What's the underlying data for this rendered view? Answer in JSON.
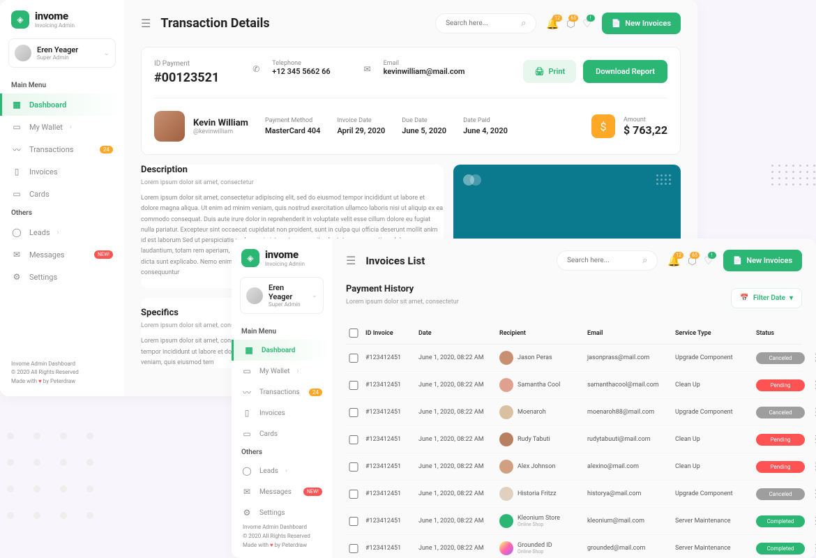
{
  "brand": {
    "title": "invome",
    "subtitle": "Invoicing Admin"
  },
  "user": {
    "name": "Eren Yeager",
    "role": "Super Admin"
  },
  "menu": {
    "main_label": "Main Menu",
    "others_label": "Others",
    "items": {
      "dashboard": "Dashboard",
      "wallet": "My Wallet",
      "transactions": "Transactions",
      "transactions_badge": "24",
      "invoices": "Invoices",
      "cards": "Cards",
      "leads": "Leads",
      "messages": "Messages",
      "messages_badge": "NEW!",
      "settings": "Settings"
    }
  },
  "footer": {
    "l1": "Invome Admin Dashboard",
    "l2": "© 2020 All Rights Reserved",
    "l3a": "Made with ",
    "l3b": " by Peterdraw"
  },
  "topbar": {
    "search_placeholder": "Search here...",
    "noti1": "12",
    "noti2": "65",
    "noti3": "!",
    "new_invoice_btn": "New Invoices"
  },
  "pageA": {
    "title": "Transaction Details",
    "id_payment_label": "ID Payment",
    "id_payment_value": "#00123521",
    "tel_label": "Telephone",
    "tel_value": "+12 345 5662 66",
    "email_label": "Email",
    "email_value": "kevinwilliam@mail.com",
    "print_btn": "Print",
    "download_btn": "Download Report",
    "customer_name": "Kevin William",
    "customer_handle": "@kevinwilliam",
    "pm_label": "Payment Method",
    "pm_value": "MasterCard 404",
    "inv_date_label": "Invoice Date",
    "inv_date_value": "April 29, 2020",
    "due_label": "Due Date",
    "due_value": "June 5, 2020",
    "paid_label": "Date Paid",
    "paid_value": "June 4, 2020",
    "amount_label": "Amount",
    "amount_value": "$ 763,22",
    "desc_title": "Description",
    "desc_sub": "Lorem ipsum dolor sit amet, consectetur",
    "desc_body": "Lorem ipsum dolor sit amet, consectetur adipiscing elit, sed do eiusmod tempor incididunt ut labore et dolore magna aliqua. Ut enim ad minim veniam, quis nostrud exercitation ullamco laboris nisi ut aliquip ex ea commodo consequat. Duis aute irure dolor in reprehenderit in voluptate velit esse cillum dolore eu fugiat nulla pariatur. Excepteur sint occaecat cupidatat non proident, sunt in culpa qui officia deserunt mollit anim id est laborum Sed ut perspiciatis unde omnis iste natus error sit voluptatem accusantium doloremque laudantium, totam rem aperiam, eaque ipsa quae ab illo inventore veritatis et quasi architecto beatae vitae dicta sunt explicabo. Nemo enim ipsam voluptatem quia voluptas sit aspernatur aut odit aut fugit, sed quia consequuntur",
    "spec_title": "Specifics",
    "spec_sub": "Lorem ipsum dolor sit amet, consectetur",
    "spec_body": "Lorem ipsum dolor sit amet, consectetur adipiscing elit, sed do eiusmod tempor incididunt ut labore et dolore magna aliqua. Ut enim ad minim veniam, quis eiusmod tem"
  },
  "pageB": {
    "title": "Invoices List",
    "history_title": "Payment History",
    "history_sub": "Lorem ipsum dolor sit amet, consectetur",
    "filter_btn": "Filter Date",
    "cols": {
      "id": "ID Invoice",
      "date": "Date",
      "recipient": "Recipient",
      "email": "Email",
      "service": "Service Type",
      "status": "Status"
    },
    "rows": [
      {
        "id": "#123412451",
        "date": "June 1, 2020, 08:22 AM",
        "name": "Jason Peras",
        "sub": "",
        "email": "jasonprass@mail.com",
        "service": "Upgrade Component",
        "status": "Canceled",
        "st": "cancel",
        "av": "#c89070"
      },
      {
        "id": "#123412451",
        "date": "June 1, 2020, 08:22 AM",
        "name": "Samantha Cool",
        "sub": "",
        "email": "samanthacool@mail.com",
        "service": "Clean Up",
        "status": "Pending",
        "st": "pending",
        "av": "#e0a090"
      },
      {
        "id": "#123412451",
        "date": "June 1, 2020, 08:22 AM",
        "name": "Moenaroh",
        "sub": "",
        "email": "moenaroh88@mail.com",
        "service": "Upgrade Component",
        "status": "Canceled",
        "st": "cancel",
        "av": "#d8c0a0"
      },
      {
        "id": "#123412451",
        "date": "June 1, 2020, 08:22 AM",
        "name": "Rudy Tabuti",
        "sub": "",
        "email": "rudytabuuti@mail.com",
        "service": "Clean Up",
        "status": "Pending",
        "st": "pending",
        "av": "#b88060"
      },
      {
        "id": "#123412451",
        "date": "June 1, 2020, 08:22 AM",
        "name": "Alex Johnson",
        "sub": "",
        "email": "alexino@mail.com",
        "service": "Clean Up",
        "status": "Pending",
        "st": "pending",
        "av": "#d0a080"
      },
      {
        "id": "#123412451",
        "date": "June 1, 2020, 08:22 AM",
        "name": "Historia Fritzz",
        "sub": "",
        "email": "historya@mail.com",
        "service": "Upgrade Component",
        "status": "Canceled",
        "st": "cancel",
        "av": "#e0d0c0"
      },
      {
        "id": "#123412451",
        "date": "June 1, 2020, 08:22 AM",
        "name": "Kleonium Store",
        "sub": "Online Shop",
        "email": "kleonium@mail.com",
        "service": "Server Maintenance",
        "status": "Completed",
        "st": "complete",
        "av": "#2bb673"
      },
      {
        "id": "#123412451",
        "date": "June 1, 2020, 08:22 AM",
        "name": "Grounded ID",
        "sub": "Online Shop",
        "email": "grounded@mail.com",
        "service": "Server Maintenance",
        "status": "Completed",
        "st": "complete",
        "av": "linear-gradient(135deg,#ff6,#f6a,#a6f)"
      }
    ]
  }
}
